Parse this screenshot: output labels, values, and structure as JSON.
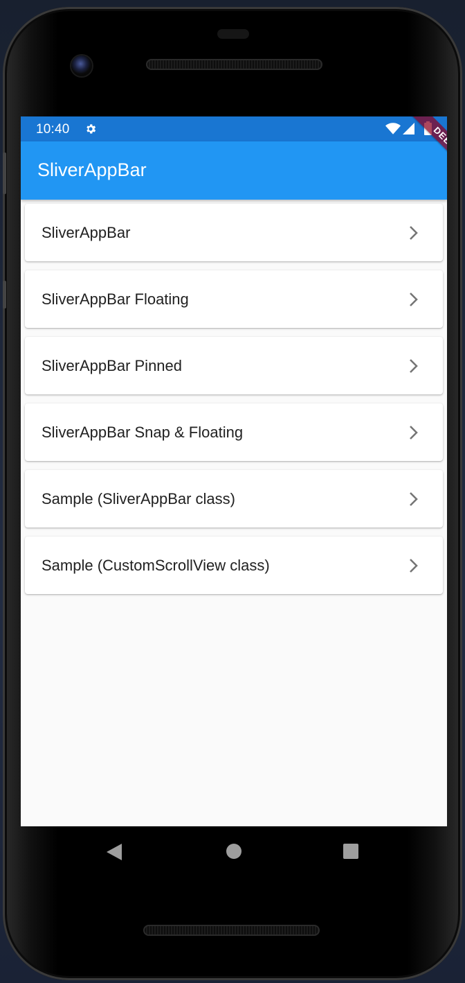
{
  "status_bar": {
    "time": "10:40",
    "icons": [
      "gear-icon",
      "wifi-icon",
      "signal-icon",
      "battery-icon"
    ],
    "color": "#1976d2"
  },
  "debug_banner": {
    "label": "DEBUG"
  },
  "app_bar": {
    "title": "SliverAppBar",
    "color": "#2196f3"
  },
  "list": {
    "items": [
      {
        "label": "SliverAppBar",
        "icon": "chevron-right-icon"
      },
      {
        "label": "SliverAppBar Floating",
        "icon": "chevron-right-icon"
      },
      {
        "label": "SliverAppBar Pinned",
        "icon": "chevron-right-icon"
      },
      {
        "label": "SliverAppBar Snap & Floating",
        "icon": "chevron-right-icon"
      },
      {
        "label": "Sample (SliverAppBar class)",
        "icon": "chevron-right-icon"
      },
      {
        "label": "Sample (CustomScrollView class)",
        "icon": "chevron-right-icon"
      }
    ]
  },
  "nav_bar": {
    "icons": [
      "back-triangle-icon",
      "home-circle-icon",
      "recents-square-icon"
    ]
  }
}
